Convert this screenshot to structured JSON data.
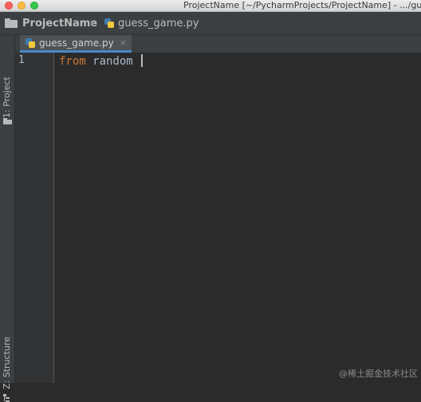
{
  "window": {
    "title": "ProjectName [~/PycharmProjects/ProjectName] - .../guess_game.py"
  },
  "navbar": {
    "project_name": "ProjectName",
    "file_name": "guess_game.py",
    "separator": "›",
    "project_icon": "folder-icon",
    "file_icon": "python-file-icon"
  },
  "sidebar": {
    "project_tab": "1: Project",
    "structure_tab": "Z: Structure"
  },
  "editor": {
    "tabs": [
      {
        "label": "guess_game.py",
        "close": "×",
        "active": true
      }
    ],
    "lines": [
      {
        "number": "1",
        "keyword": "from",
        "rest": " random "
      }
    ]
  },
  "watermark": "@稀土掘金技术社区",
  "colors": {
    "background": "#2b2b2b",
    "keyword": "#cc7832",
    "identifier": "#a9b7c6",
    "active_tab_accent": "#4a88c7"
  }
}
